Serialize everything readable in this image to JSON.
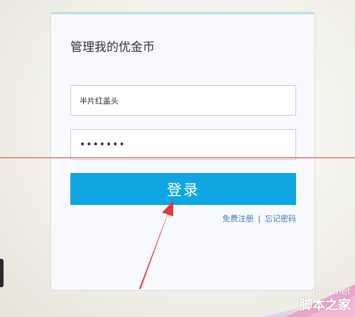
{
  "login_panel": {
    "title": "管理我的优金币",
    "username_value": "半片红盖头",
    "password_masked": "•••••••",
    "login_button_label": "登录",
    "register_link": "免费注册",
    "link_separator": "|",
    "forgot_link": "忘记密码"
  },
  "annotation": {
    "line_color": "#e23a3a",
    "arrow_color": "#e23a3a"
  },
  "watermark": {
    "site": "jb51.net",
    "brand": "脚本之家"
  },
  "colors": {
    "button": "#0ea6e3",
    "link": "#3d79b8",
    "panel_top_border": "#b9dcea"
  }
}
